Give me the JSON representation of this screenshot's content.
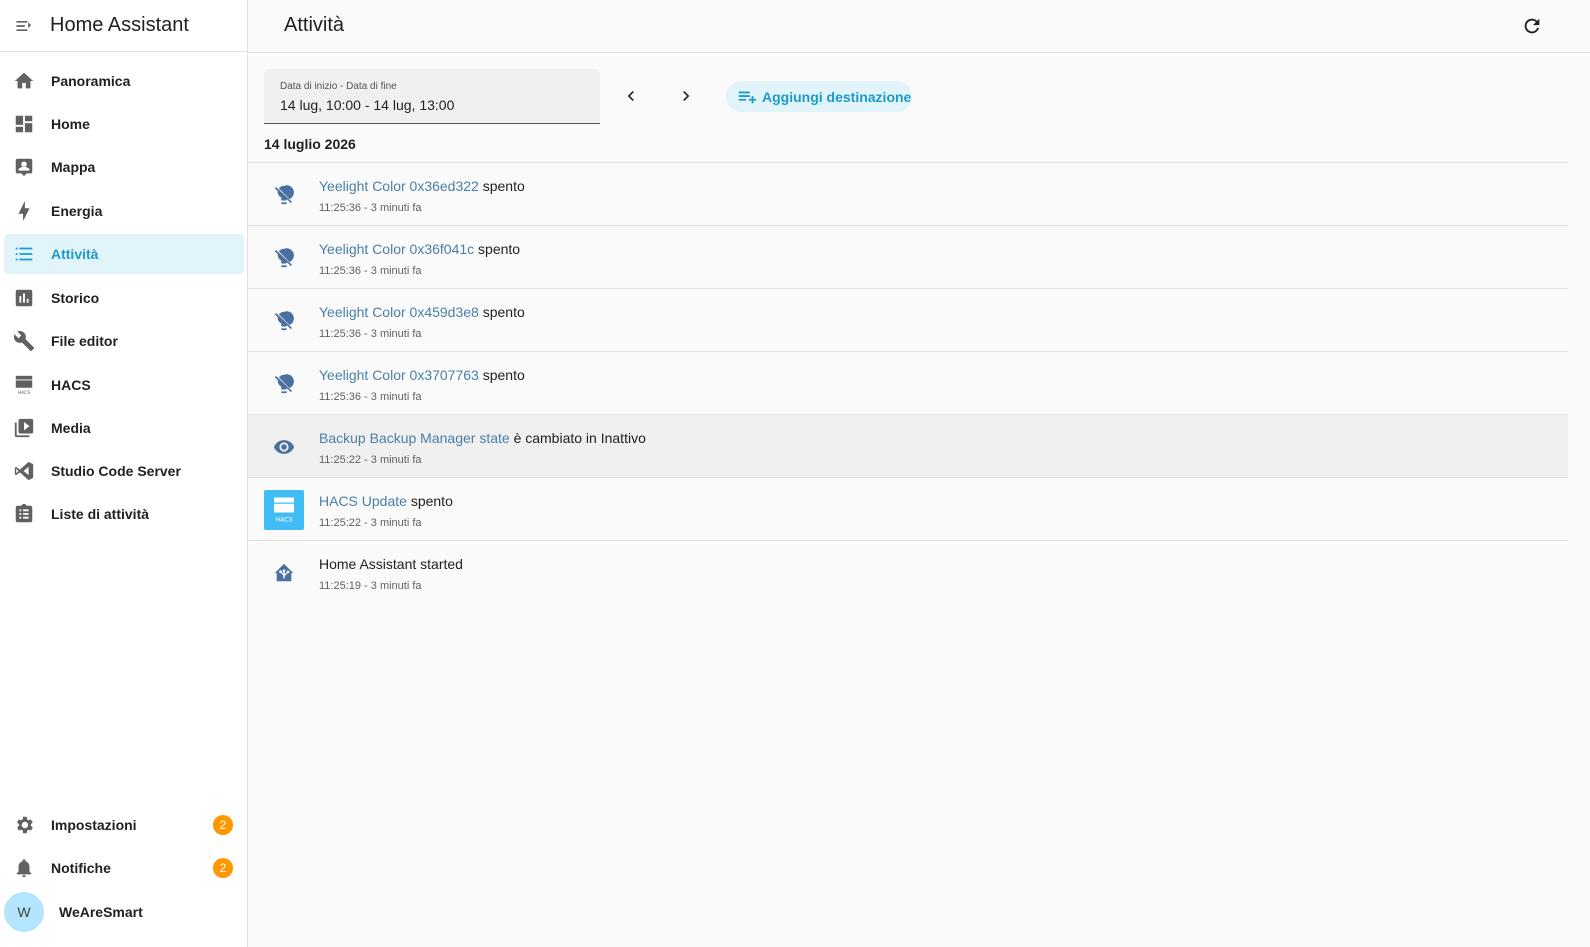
{
  "app": {
    "title": "Home Assistant"
  },
  "sidebar": {
    "items": [
      {
        "label": "Panoramica",
        "icon": "home-icon"
      },
      {
        "label": "Home",
        "icon": "dashboard-icon"
      },
      {
        "label": "Mappa",
        "icon": "map-person-icon"
      },
      {
        "label": "Energia",
        "icon": "lightning-icon"
      },
      {
        "label": "Attività",
        "icon": "logbook-list-icon",
        "active": true
      },
      {
        "label": "Storico",
        "icon": "chart-bar-icon"
      },
      {
        "label": "File editor",
        "icon": "wrench-icon"
      },
      {
        "label": "HACS",
        "icon": "hacs-icon"
      },
      {
        "label": "Media",
        "icon": "play-box-icon"
      },
      {
        "label": "Studio Code Server",
        "icon": "vscode-icon"
      },
      {
        "label": "Liste di attività",
        "icon": "clipboard-list-icon"
      }
    ],
    "settings": {
      "label": "Impostazioni",
      "badge": "2"
    },
    "notifications": {
      "label": "Notifiche",
      "badge": "2"
    },
    "user": {
      "name": "WeAreSmart",
      "initial": "W"
    }
  },
  "page": {
    "title": "Attività"
  },
  "date_picker": {
    "label": "Data di inizio - Data di fine",
    "value": "14 lug, 10:00 - 14 lug, 13:00"
  },
  "add_target": {
    "label": "Aggiungi destinazione"
  },
  "day_heading": "14 luglio 2026",
  "entries": [
    {
      "entity": "Yeelight Color 0x36ed322",
      "message": "spento",
      "time": "11:25:36 - 3 minuti fa",
      "icon": "lightbulb-off-icon"
    },
    {
      "entity": "Yeelight Color 0x36f041c",
      "message": "spento",
      "time": "11:25:36 - 3 minuti fa",
      "icon": "lightbulb-off-icon"
    },
    {
      "entity": "Yeelight Color 0x459d3e8",
      "message": "spento",
      "time": "11:25:36 - 3 minuti fa",
      "icon": "lightbulb-off-icon"
    },
    {
      "entity": "Yeelight Color 0x3707763",
      "message": "spento",
      "time": "11:25:36 - 3 minuti fa",
      "icon": "lightbulb-off-icon"
    },
    {
      "entity": "Backup Backup Manager state",
      "message": "è cambiato in Inattivo",
      "time": "11:25:22 - 3 minuti fa",
      "icon": "eye-icon"
    },
    {
      "entity": "HACS Update",
      "message": "spento",
      "time": "11:25:22 - 3 minuti fa",
      "icon": "hacs-icon"
    },
    {
      "entity": "",
      "message": "Home Assistant started",
      "time": "11:25:19 - 3 minuti fa",
      "icon": "home-assistant-icon"
    }
  ],
  "colors": {
    "accent": "#1e9ac8",
    "entity_link": "#4a7fa8",
    "badge": "#ff9800",
    "active_bg": "#e1f4fa"
  }
}
